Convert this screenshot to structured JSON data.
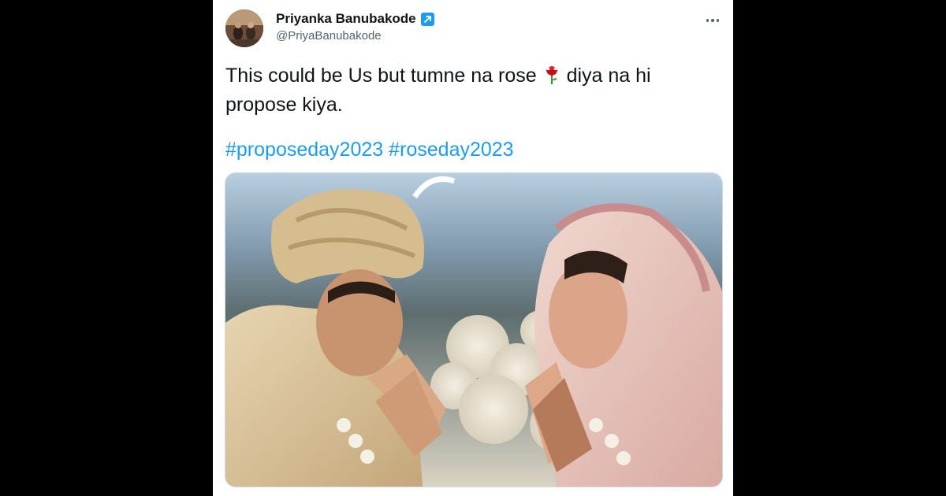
{
  "tweet": {
    "author_name": "Priyanka Banubakode",
    "author_handle": "@PriyaBanubakode",
    "text_part1": "This could be Us but tumne na rose",
    "text_part2": "diya na hi propose kiya.",
    "hashtags": [
      "#proposeday2023",
      "#roseday2023"
    ],
    "emoji": "rose-emoji"
  },
  "icons": {
    "badge": "arrow-up-right-icon",
    "more": "more-horizontal-icon"
  },
  "colors": {
    "accent": "#1d9bf0",
    "text": "#0f1419",
    "secondary": "#536471",
    "backdrop": "#000000"
  }
}
